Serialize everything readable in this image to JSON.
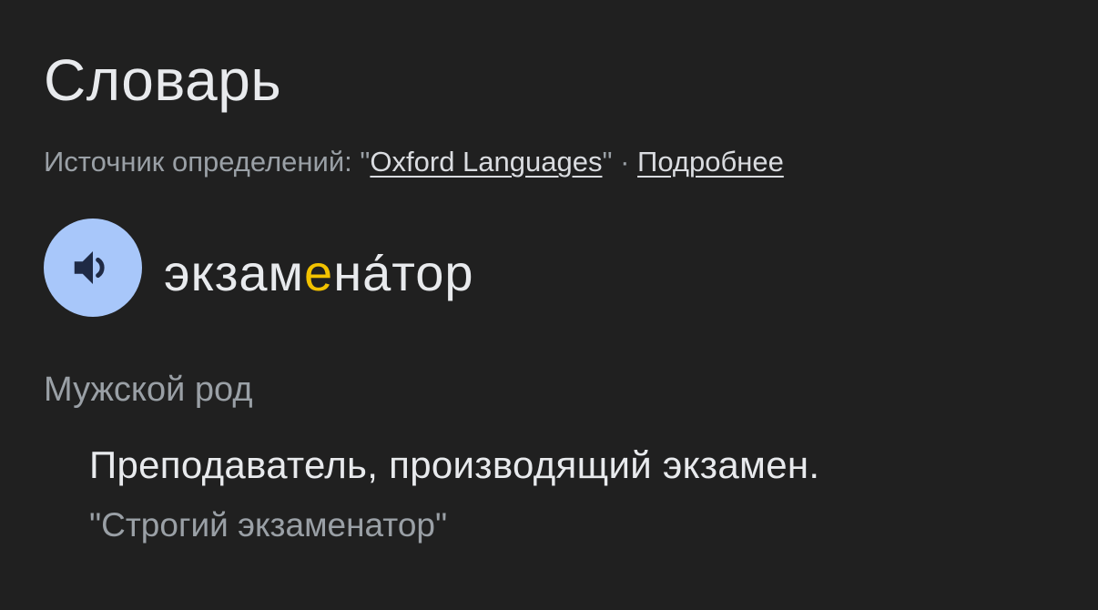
{
  "dictionary": {
    "title": "Словарь",
    "source": {
      "prefix": "Источник определений: \"",
      "link_label": "Oxford Languages",
      "separator": "\" · ",
      "more_label": "Подробнее"
    },
    "entry": {
      "word_before_stress": "экзам",
      "stressed_letter": "е",
      "word_after_stress": "на́тор",
      "speaker_icon": "volume-icon",
      "part_of_speech": "Мужской род",
      "definition": "Преподаватель, производящий экзамен.",
      "example": "\"Строгий экзаменатор\""
    }
  },
  "colors": {
    "background": "#202020",
    "text_primary": "#e8eaed",
    "text_secondary": "#9aa0a6",
    "speaker_button": "#a8c7fa",
    "stress_highlight": "#f2c200"
  }
}
